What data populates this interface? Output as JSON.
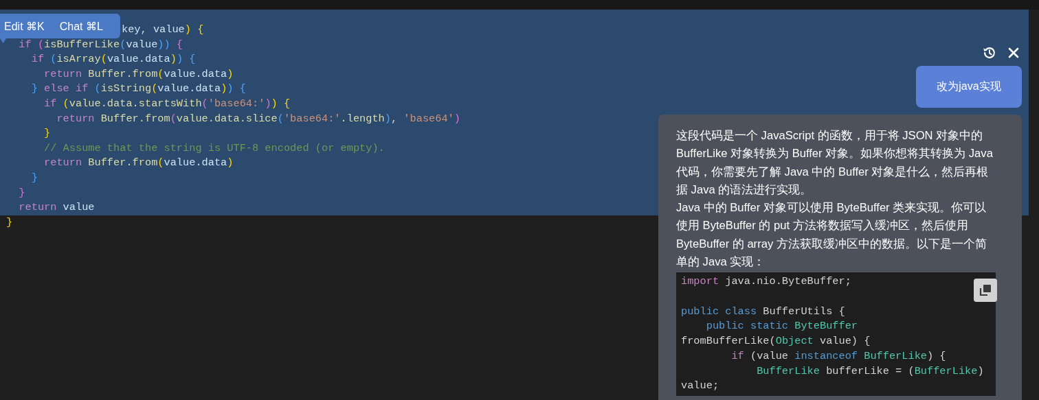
{
  "editor": {
    "lines": [
      {
        "selected": true,
        "tokens": [
          {
            "text": "key",
            "kind": "var"
          },
          {
            "text": ", ",
            "kind": "plain"
          },
          {
            "text": "value",
            "kind": "var"
          },
          {
            "text": ")",
            "kind": "b1"
          },
          {
            "text": " {",
            "kind": "b1"
          }
        ]
      },
      {
        "selected": true,
        "tokens": [
          {
            "text": "  if",
            "kind": "kw"
          },
          {
            "text": " (",
            "kind": "b2"
          },
          {
            "text": "isBufferLike",
            "kind": "fn"
          },
          {
            "text": "(",
            "kind": "b3"
          },
          {
            "text": "value",
            "kind": "var"
          },
          {
            "text": "))",
            "kind": "b3"
          },
          {
            "text": " {",
            "kind": "b2"
          }
        ]
      },
      {
        "selected": true,
        "tokens": [
          {
            "text": "    if",
            "kind": "kw"
          },
          {
            "text": " (",
            "kind": "b3"
          },
          {
            "text": "isArray",
            "kind": "fn"
          },
          {
            "text": "(",
            "kind": "b1"
          },
          {
            "text": "value.data",
            "kind": "var"
          },
          {
            "text": ")",
            "kind": "b1"
          },
          {
            "text": ")",
            "kind": "b3"
          },
          {
            "text": " {",
            "kind": "b3"
          }
        ]
      },
      {
        "selected": true,
        "tokens": [
          {
            "text": "      return",
            "kind": "kw"
          },
          {
            "text": " Buffer.from",
            "kind": "fn"
          },
          {
            "text": "(",
            "kind": "b1"
          },
          {
            "text": "value.data",
            "kind": "var"
          },
          {
            "text": ")",
            "kind": "b1"
          }
        ]
      },
      {
        "selected": true,
        "tokens": [
          {
            "text": "    }",
            "kind": "b3"
          },
          {
            "text": " else if",
            "kind": "kw"
          },
          {
            "text": " (",
            "kind": "b3"
          },
          {
            "text": "isString",
            "kind": "fn"
          },
          {
            "text": "(",
            "kind": "b1"
          },
          {
            "text": "value.data",
            "kind": "var"
          },
          {
            "text": ")",
            "kind": "b1"
          },
          {
            "text": ")",
            "kind": "b3"
          },
          {
            "text": " {",
            "kind": "b3"
          }
        ]
      },
      {
        "selected": true,
        "tokens": [
          {
            "text": "      if",
            "kind": "kw"
          },
          {
            "text": " (",
            "kind": "b1"
          },
          {
            "text": "value.data.startsWith",
            "kind": "fn"
          },
          {
            "text": "(",
            "kind": "b2"
          },
          {
            "text": "'base64:'",
            "kind": "str"
          },
          {
            "text": ")",
            "kind": "b2"
          },
          {
            "text": ")",
            "kind": "b1"
          },
          {
            "text": " {",
            "kind": "b1"
          }
        ]
      },
      {
        "selected": true,
        "tokens": [
          {
            "text": "        return",
            "kind": "kw"
          },
          {
            "text": " Buffer.from",
            "kind": "fn"
          },
          {
            "text": "(",
            "kind": "b2"
          },
          {
            "text": "value.data.slice",
            "kind": "fn"
          },
          {
            "text": "(",
            "kind": "b3"
          },
          {
            "text": "'base64:'",
            "kind": "str"
          },
          {
            "text": ".length",
            "kind": "fn"
          },
          {
            "text": ")",
            "kind": "b3"
          },
          {
            "text": ", ",
            "kind": "plain"
          },
          {
            "text": "'base64'",
            "kind": "str"
          },
          {
            "text": ")",
            "kind": "b2"
          }
        ]
      },
      {
        "selected": true,
        "tokens": [
          {
            "text": "      }",
            "kind": "b1"
          }
        ]
      },
      {
        "selected": true,
        "tokens": [
          {
            "text": "      // Assume that the string is UTF-8 encoded (or empty).",
            "kind": "com"
          }
        ]
      },
      {
        "selected": true,
        "tokens": [
          {
            "text": "      return",
            "kind": "kw"
          },
          {
            "text": " Buffer.from",
            "kind": "fn"
          },
          {
            "text": "(",
            "kind": "b1"
          },
          {
            "text": "value.data",
            "kind": "var"
          },
          {
            "text": ")",
            "kind": "b1"
          }
        ]
      },
      {
        "selected": true,
        "tokens": [
          {
            "text": "    }",
            "kind": "b3"
          }
        ]
      },
      {
        "selected": true,
        "tokens": [
          {
            "text": "  }",
            "kind": "b2"
          }
        ]
      },
      {
        "selected": true,
        "tokens": [
          {
            "text": "  return",
            "kind": "kw"
          },
          {
            "text": " value",
            "kind": "var"
          }
        ]
      },
      {
        "selected": false,
        "tokens": [
          {
            "text": "}",
            "kind": "b1"
          }
        ]
      }
    ]
  },
  "popup": {
    "tabs": [
      {
        "label": "Edit ⌘K"
      },
      {
        "label": "Chat ⌘L"
      }
    ]
  },
  "chat": {
    "user_message": "改为java实现",
    "reply_paragraphs": [
      "这段代码是一个 JavaScript 的函数，用于将 JSON 对象中的 BufferLike 对象转换为 Buffer 对象。如果你想将其转换为 Java 代码，你需要先了解 Java 中的 Buffer 对象是什么，然后再根据 Java 的语法进行实现。",
      "Java 中的 Buffer 对象可以使用 ByteBuffer 类来实现。你可以使用 ByteBuffer 的 put 方法将数据写入缓冲区，然后使用 ByteBuffer 的 array 方法获取缓冲区中的数据。以下是一个简单的 Java 实现："
    ],
    "code_lines": [
      {
        "tokens": [
          {
            "text": "import",
            "kind": "kw"
          },
          {
            "text": " java.nio.ByteBuffer;",
            "kind": "plain"
          }
        ]
      },
      {
        "kind": "blank"
      },
      {
        "tokens": [
          {
            "text": "public class",
            "kind": "decl"
          },
          {
            "text": " BufferUtils {",
            "kind": "plain"
          }
        ]
      },
      {
        "tokens": [
          {
            "text": "    public static",
            "kind": "decl"
          },
          {
            "text": " ByteBuffer",
            "kind": "type"
          }
        ]
      },
      {
        "tokens": [
          {
            "text": "fromBufferLike(",
            "kind": "plain"
          },
          {
            "text": "Object",
            "kind": "type"
          },
          {
            "text": " value) {",
            "kind": "plain"
          }
        ]
      },
      {
        "tokens": [
          {
            "text": "        if",
            "kind": "kw"
          },
          {
            "text": " (value ",
            "kind": "plain"
          },
          {
            "text": "instanceof",
            "kind": "decl"
          },
          {
            "text": " BufferLike",
            "kind": "type"
          },
          {
            "text": ") {",
            "kind": "plain"
          }
        ]
      },
      {
        "tokens": [
          {
            "text": "            BufferLike",
            "kind": "type"
          },
          {
            "text": " bufferLike = (",
            "kind": "plain"
          },
          {
            "text": "BufferLike",
            "kind": "type"
          },
          {
            "text": ")",
            "kind": "plain"
          }
        ]
      },
      {
        "tokens": [
          {
            "text": "value;",
            "kind": "plain"
          }
        ]
      }
    ]
  }
}
